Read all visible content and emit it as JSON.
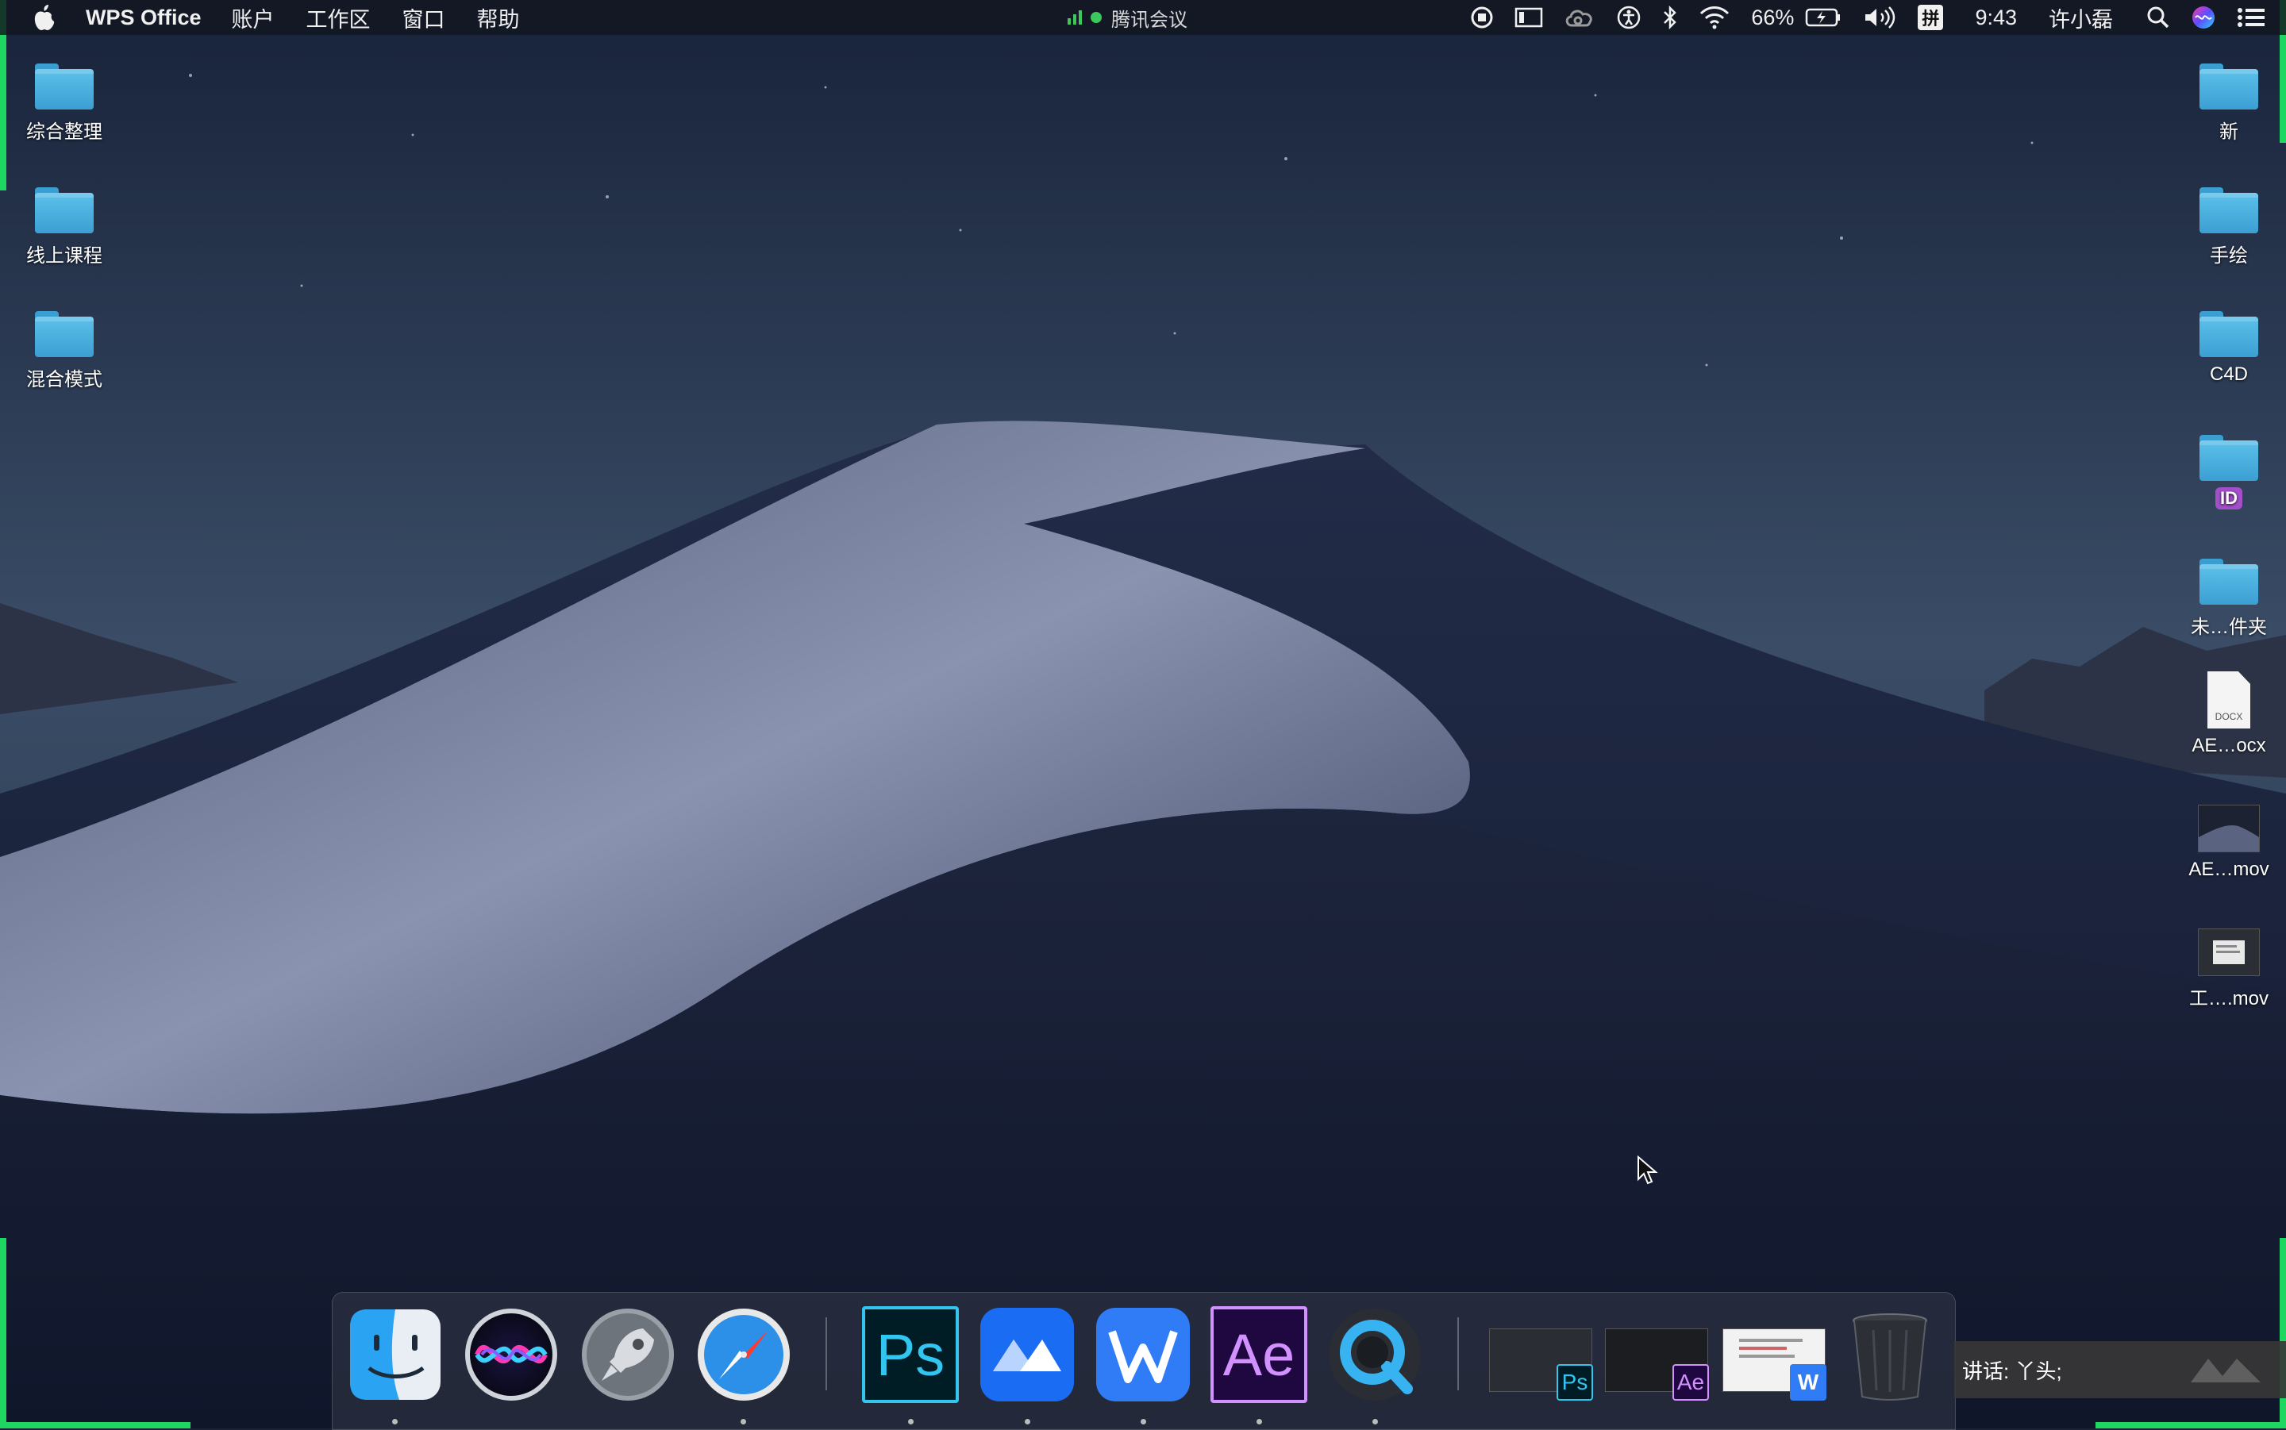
{
  "menubar": {
    "app_name": "WPS Office",
    "menus": [
      "账户",
      "工作区",
      "窗口",
      "帮助"
    ],
    "center_app": "腾讯会议",
    "battery": "66%",
    "ime": "拼",
    "time": "9:43",
    "user": "许小磊",
    "status_icons": [
      "record-icon",
      "display-icon",
      "creative-cloud-icon",
      "accessibility-icon",
      "bluetooth-icon",
      "wifi-icon",
      "battery-icon",
      "volume-icon",
      "spotlight-icon",
      "siri-icon",
      "notification-center-icon"
    ]
  },
  "desktop": {
    "left_icons": [
      {
        "label": "综合整理",
        "type": "folder"
      },
      {
        "label": "线上课程",
        "type": "folder"
      },
      {
        "label": "混合模式",
        "type": "folder"
      }
    ],
    "right_icons": [
      {
        "label": "新",
        "type": "folder"
      },
      {
        "label": "手绘",
        "type": "folder"
      },
      {
        "label": "C4D",
        "type": "folder"
      },
      {
        "label": "",
        "type": "folder",
        "badge": "ID"
      },
      {
        "label": "未…件夹",
        "type": "folder"
      },
      {
        "label": "AE…ocx",
        "type": "docx",
        "file_tag": "DOCX"
      },
      {
        "label": "AE…mov",
        "type": "movie"
      },
      {
        "label": "工….mov",
        "type": "movie"
      }
    ]
  },
  "dock": {
    "apps": [
      {
        "name": "Finder",
        "icon": "finder-icon",
        "running": true
      },
      {
        "name": "Siri",
        "icon": "siri-icon",
        "running": false
      },
      {
        "name": "Launchpad",
        "icon": "launchpad-icon",
        "running": false
      },
      {
        "name": "Safari",
        "icon": "safari-icon",
        "running": true
      },
      {
        "name": "Photoshop",
        "icon": "photoshop-icon",
        "glyph": "Ps",
        "running": true
      },
      {
        "name": "腾讯会议",
        "icon": "tencent-meeting-icon",
        "running": true
      },
      {
        "name": "WPS Office",
        "icon": "wps-icon",
        "running": true
      },
      {
        "name": "After Effects",
        "icon": "after-effects-icon",
        "glyph": "Ae",
        "running": true
      },
      {
        "name": "QuickTime Player",
        "icon": "quicktime-icon",
        "running": true
      }
    ],
    "minimized": [
      {
        "badge": "Ps"
      },
      {
        "badge": "Ae"
      },
      {
        "badge": "W"
      }
    ],
    "trash": "trash-icon"
  },
  "notification": {
    "text": "讲话: 丫头;"
  },
  "colors": {
    "accent_green": "#1ed760",
    "folder_blue": "#4fb3e3",
    "ps_blue": "#31c5f0",
    "ae_purple": "#d291ff"
  }
}
